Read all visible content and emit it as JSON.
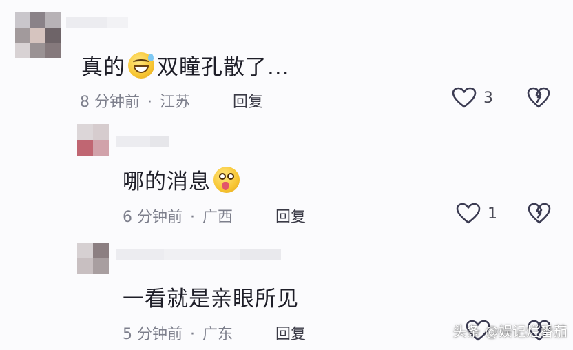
{
  "comments": [
    {
      "text_before": "真的",
      "emoji": "grinning-sweat-emoji",
      "text_after": "双瞳孔散了...",
      "time": "8 分钟前",
      "location": "江苏",
      "reply_label": "回复",
      "like_count": "3"
    },
    {
      "text_before": "哪的消息",
      "emoji": "dizzy-face-emoji",
      "text_after": "",
      "time": "6 分钟前",
      "location": "广西",
      "reply_label": "回复",
      "like_count": "1"
    },
    {
      "text_before": "一看就是亲眼所见",
      "emoji": "",
      "text_after": "",
      "time": "5 分钟前",
      "location": "广东",
      "reply_label": "回复",
      "like_count": ""
    }
  ],
  "separator": "·",
  "watermark": "头条 @娱记烂番茄",
  "colors": {
    "background": "#fbfbfd",
    "text": "#1e1e28",
    "meta": "#7d7f8c",
    "icon_stroke": "#3b3b52"
  }
}
